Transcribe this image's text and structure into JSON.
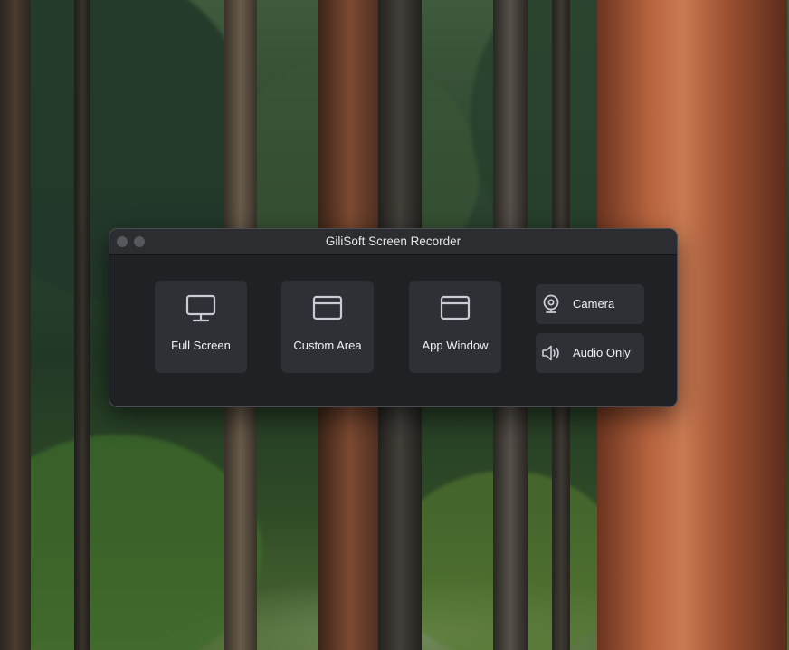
{
  "window": {
    "title": "GiliSoft Screen Recorder"
  },
  "modes": {
    "full_screen": {
      "label": "Full Screen",
      "icon": "monitor-icon"
    },
    "custom_area": {
      "label": "Custom Area",
      "icon": "window-frame-icon"
    },
    "app_window": {
      "label": "App Window",
      "icon": "window-frame-icon"
    },
    "camera": {
      "label": "Camera",
      "icon": "webcam-icon"
    },
    "audio_only": {
      "label": "Audio Only",
      "icon": "speaker-icon"
    }
  },
  "colors": {
    "window_background": "#1f2125",
    "titlebar_background": "#2b2d31",
    "button_background": "#2d3136",
    "icon_stroke": "#c9ccd2",
    "text": "#f1f1f3"
  }
}
